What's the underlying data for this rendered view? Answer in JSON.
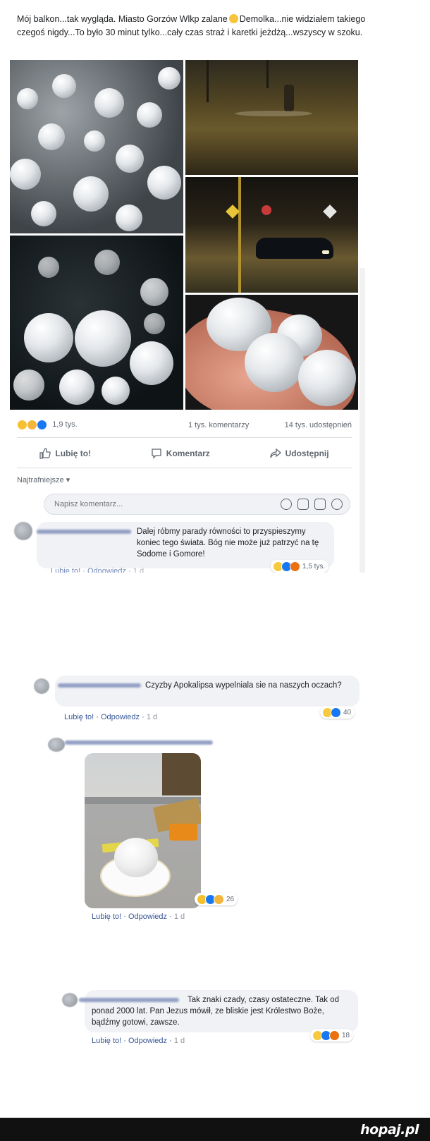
{
  "post": {
    "text_before_emoji": "Mój balkon...tak wygląda. Miasto Gorzów Wlkp zalane",
    "text_after_emoji": "Demolka...nie widziałem takiego czegoś nigdy...To było 30 minut tylko...cały czas straż i karetki jeżdżą...wszyscy w szoku.",
    "reactions_count": "1,9 tys.",
    "comments_count": "1 tys. komentarzy",
    "shares_count": "14 tys. udostępnień",
    "like_label": "Lubię to!",
    "comment_label": "Komentarz",
    "share_label": "Udostępnij",
    "sort_label": "Najtrafniejsze ▾",
    "comment_placeholder": "Napisz komentarz..."
  },
  "comments": [
    {
      "text": "Dalej róbmy parady równości to przyspieszymy koniec tego świata. Bóg nie może już patrzyć na tę Sodome i Gomore!",
      "reactions": "1,5 tys.",
      "meta_like": "Lubię to!",
      "meta_reply": "Odpowiedz",
      "meta_time": "1 d"
    },
    {
      "text": "Czyzby Apokalipsa wypelniala sie na naszych oczach?",
      "reactions": "40",
      "meta_like": "Lubię to!",
      "meta_reply": "Odpowiedz",
      "meta_time": "1 d"
    },
    {
      "text": "",
      "reactions": "26",
      "meta_like": "Lubię to!",
      "meta_reply": "Odpowiedz",
      "meta_time": "1 d"
    },
    {
      "text": "Tak znaki czady, czasy ostateczne. Tak od ponad 2000 lat. Pan Jezus mówił, ze bliskie jest Królestwo Boże, bądźmy gotowi, zawsze.",
      "reactions": "18",
      "meta_like": "Lubię to!",
      "meta_reply": "Odpowiedz",
      "meta_time": "1 d"
    }
  ],
  "footer": {
    "logo": "hopaj.pl"
  },
  "colors": {
    "link": "#385898",
    "like_blue": "#1877f2",
    "bubble": "#f0f2f5",
    "footer": "#111111"
  }
}
